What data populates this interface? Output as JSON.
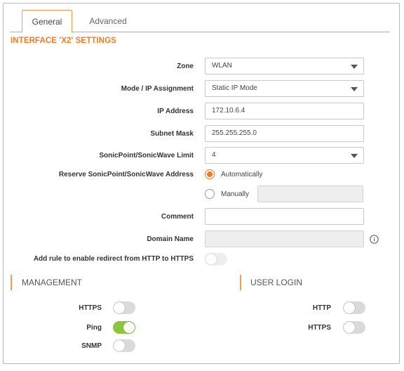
{
  "tabs": [
    {
      "label": "General",
      "active": true
    },
    {
      "label": "Advanced",
      "active": false
    }
  ],
  "section_title": "INTERFACE 'X2' SETTINGS",
  "form": {
    "zone": {
      "label": "Zone",
      "value": "WLAN"
    },
    "mode": {
      "label": "Mode / IP Assignment",
      "value": "Static IP Mode"
    },
    "ip": {
      "label": "IP Address",
      "value": "172.10.6.4"
    },
    "subnet": {
      "label": "Subnet Mask",
      "value": "255.255.255.0"
    },
    "limit": {
      "label": "SonicPoint/SonicWave Limit",
      "value": "4"
    },
    "reserve": {
      "label": "Reserve SonicPoint/SonicWave Address",
      "option_auto": "Automatically",
      "option_manual": "Manually",
      "selected": "Automatically",
      "manual_value": ""
    },
    "comment": {
      "label": "Comment",
      "value": ""
    },
    "domain": {
      "label": "Domain Name",
      "value": ""
    },
    "redirect": {
      "label": "Add rule to enable redirect from HTTP to HTTPS",
      "enabled": false
    }
  },
  "management": {
    "title": "MANAGEMENT",
    "items": [
      {
        "label": "HTTPS",
        "enabled": false
      },
      {
        "label": "Ping",
        "enabled": true
      },
      {
        "label": "SNMP",
        "enabled": false
      }
    ]
  },
  "user_login": {
    "title": "USER LOGIN",
    "items": [
      {
        "label": "HTTP",
        "enabled": false
      },
      {
        "label": "HTTPS",
        "enabled": false
      }
    ]
  },
  "colors": {
    "accent": "#f07c22",
    "toggle_on": "#8cc63e",
    "toggle_off": "#dadada"
  },
  "icons": {
    "dropdown": "chevron-down-icon",
    "info": "info-icon"
  }
}
